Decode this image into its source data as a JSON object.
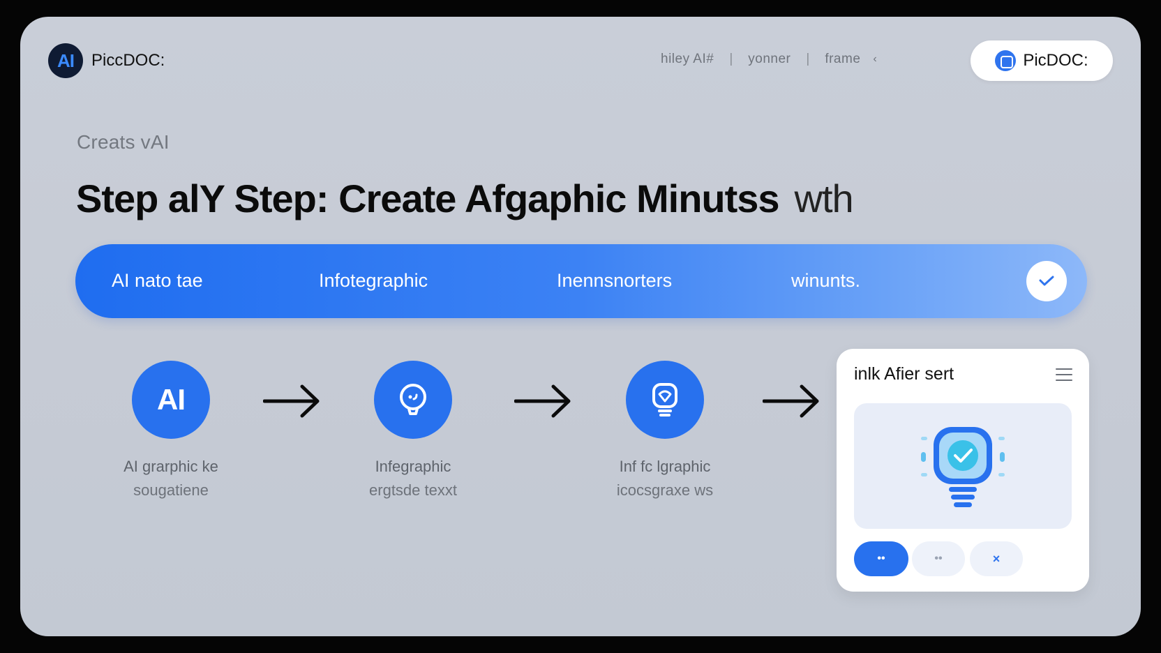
{
  "header": {
    "logo_badge": "AI",
    "logo_text": "PiccDOC:",
    "nav": [
      "hiley AI#",
      "yonner",
      "frame"
    ],
    "nav_chevron": "‹",
    "cta_label": "PicDOC:"
  },
  "hero": {
    "eyebrow": "Creats vAI",
    "headline": "Step alY Step: Create Afgaphic Minutss",
    "headline_suffix": "wth"
  },
  "bar": {
    "items": [
      "AI nato tae",
      "Infotegraphic",
      "Inennsnorters",
      "winunts."
    ],
    "check_icon": "check-icon"
  },
  "steps": [
    {
      "icon": "ai-text-icon",
      "badge": "AI",
      "line1": "AI grarphic ke",
      "line2": "sougatiene"
    },
    {
      "icon": "chat-bubble-icon",
      "line1": "Infegraphic",
      "line2": "ergtsde texxt"
    },
    {
      "icon": "shield-lightbulb-icon",
      "line1": "Inf fc lgraphic",
      "line2": "icocsgraxe ws"
    }
  ],
  "card": {
    "title": "inlk Afier sert",
    "menu_icon": "hamburger-menu-icon",
    "preview_icon": "lightbulb-check-icon",
    "buttons": [
      "••",
      "••",
      "×"
    ]
  },
  "colors": {
    "accent": "#2871ee",
    "frame_bg": "#c8cdd7",
    "card_bg": "#ffffff"
  }
}
